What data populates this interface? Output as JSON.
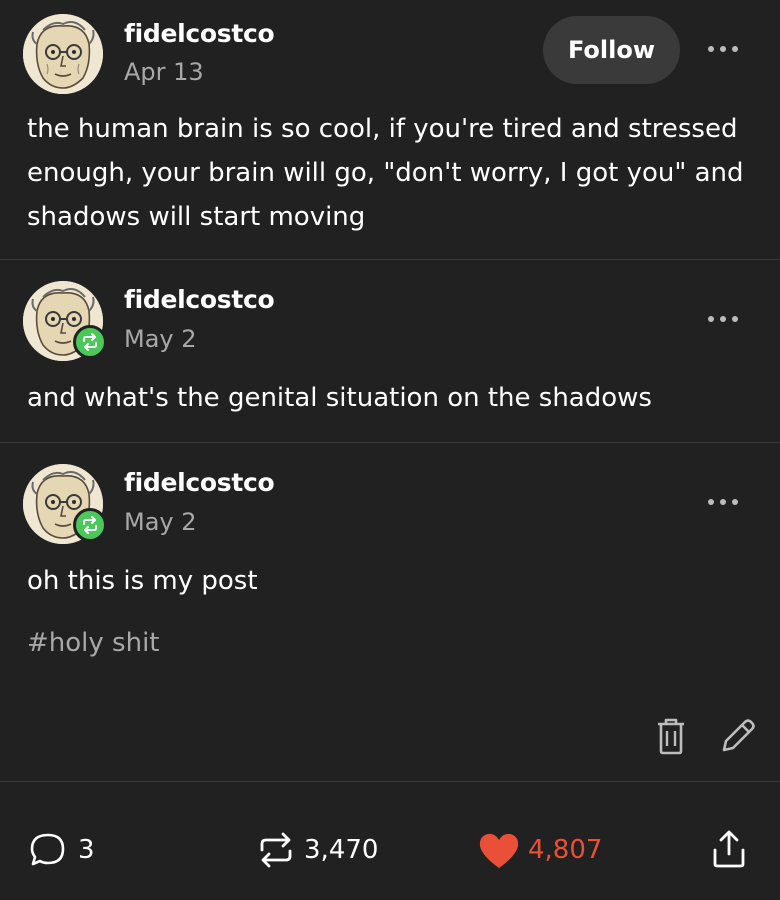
{
  "posts": [
    {
      "username": "fidelcostco",
      "date": "Apr 13",
      "follow_label": "Follow",
      "body": "the human brain is so cool, if you're tired and stressed enough, your brain will go, \"don't worry, I got you\" and shadows will start moving"
    },
    {
      "username": "fidelcostco",
      "date": "May 2",
      "body": "and what's the genital situation on the shadows"
    },
    {
      "username": "fidelcostco",
      "date": "May 2",
      "body": "oh this is my post",
      "tag": "#holy shit"
    }
  ],
  "footer": {
    "comments": "3",
    "reblogs": "3,470",
    "likes": "4,807"
  },
  "colors": {
    "background": "#212121",
    "text": "#ffffff",
    "muted": "#a8a8a8",
    "reblog_green": "#4bc85a",
    "like_red": "#ea4f37"
  },
  "icons": [
    "more-icon",
    "reblog-icon",
    "delete-icon",
    "edit-icon",
    "comment-icon",
    "heart-icon",
    "share-icon"
  ]
}
